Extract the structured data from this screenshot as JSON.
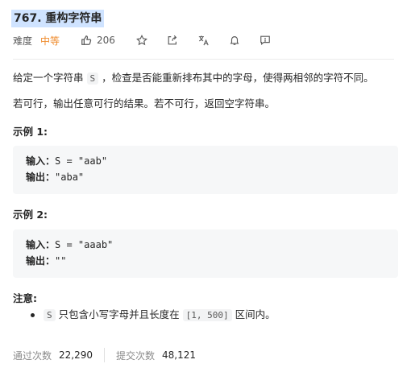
{
  "problem": {
    "title": "767. 重构字符串",
    "difficulty_label": "难度",
    "difficulty": "中等",
    "likes": "206"
  },
  "description": {
    "intro_pre": "给定一个字符串",
    "intro_var": "S",
    "intro_post": "，检查是否能重新排布其中的字母，使得两相邻的字符不同。",
    "para2": "若可行，输出任意可行的结果。若不可行，返回空字符串。"
  },
  "examples": [
    {
      "heading": "示例 1:",
      "input_label": "输入：",
      "input": "S = \"aab\"",
      "output_label": "输出：",
      "output": "\"aba\""
    },
    {
      "heading": "示例 2:",
      "input_label": "输入：",
      "input": "S = \"aaab\"",
      "output_label": "输出：",
      "output": "\"\""
    }
  ],
  "note": {
    "heading": "注意:",
    "var": "S",
    "text1": "只包含小写字母并且长度在",
    "range": "[1, 500]",
    "text2": "区间内。"
  },
  "stats": {
    "accepted_label": "通过次数",
    "accepted": "22,290",
    "submissions_label": "提交次数",
    "submissions": "48,121"
  },
  "icons": [
    "thumbs-up-icon",
    "star-icon",
    "share-icon",
    "translate-icon",
    "bell-icon",
    "comment-icon"
  ]
}
